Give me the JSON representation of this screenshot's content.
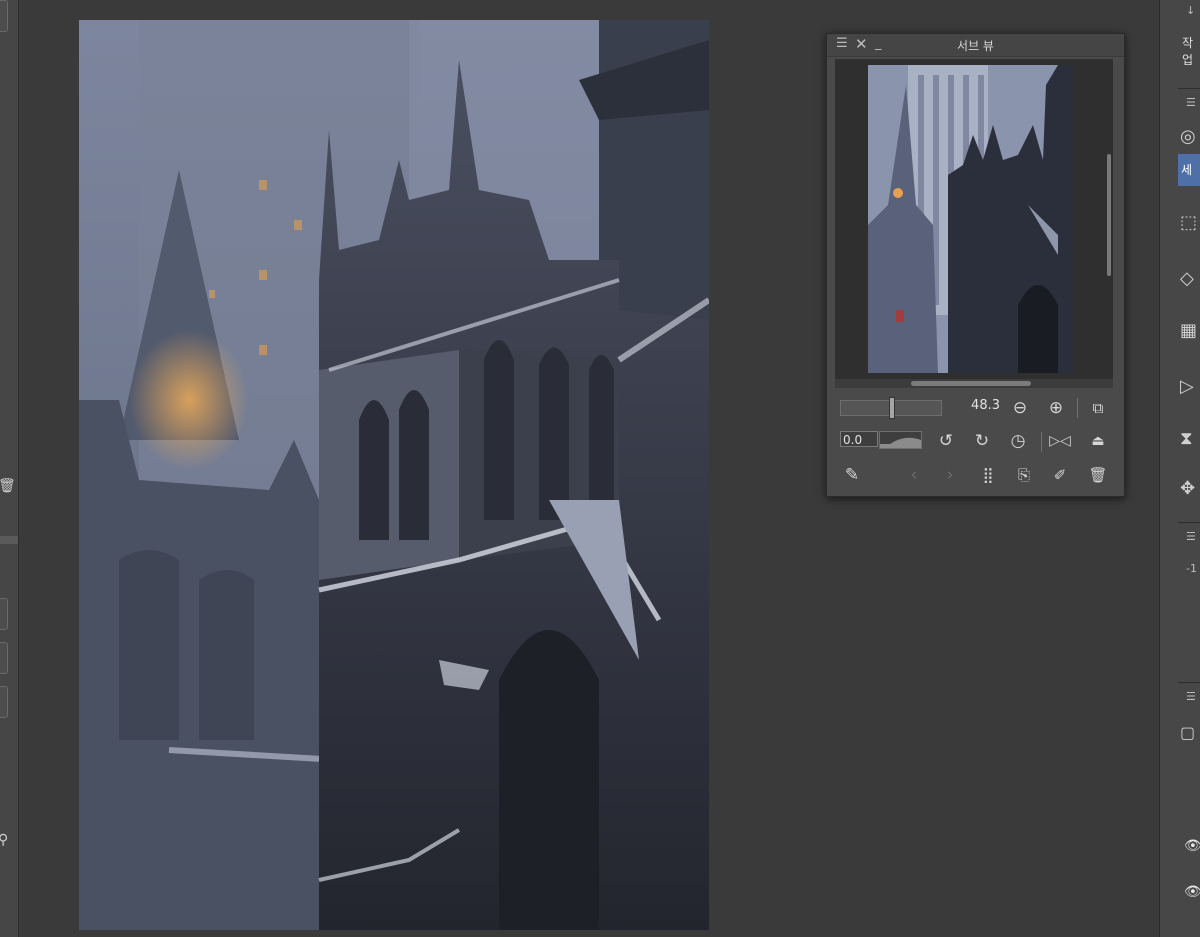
{
  "subview": {
    "title": "서브 뷰",
    "zoom_value": "48.3",
    "rotation_value": "0.0",
    "icons": {
      "menu": "hamburger-icon",
      "close": "close-icon",
      "minimize": "minimize-icon",
      "zoom_out": "zoom-out-icon",
      "zoom_in": "zoom-in-icon",
      "fit": "fit-view-icon",
      "rotate_left": "rotate-left-icon",
      "rotate_right": "rotate-right-icon",
      "reset_rotation": "reset-rotation-icon",
      "flip_h": "flip-horizontal-icon",
      "flip_v": "flip-vertical-icon",
      "eyedropper": "eyedropper-icon",
      "prev": "chevron-left-icon",
      "next": "chevron-right-icon",
      "grid": "grid-icon",
      "import": "import-image-icon",
      "edit": "edit-icon",
      "delete": "trash-icon"
    }
  },
  "right_panel": {
    "partial_label": "작업",
    "selected_tab_label": "세",
    "partial_value": "-1"
  },
  "colors": {
    "app_bg": "#3a3a3a",
    "panel_bg": "#4a4a4a",
    "accent": "#4f6fa8"
  }
}
